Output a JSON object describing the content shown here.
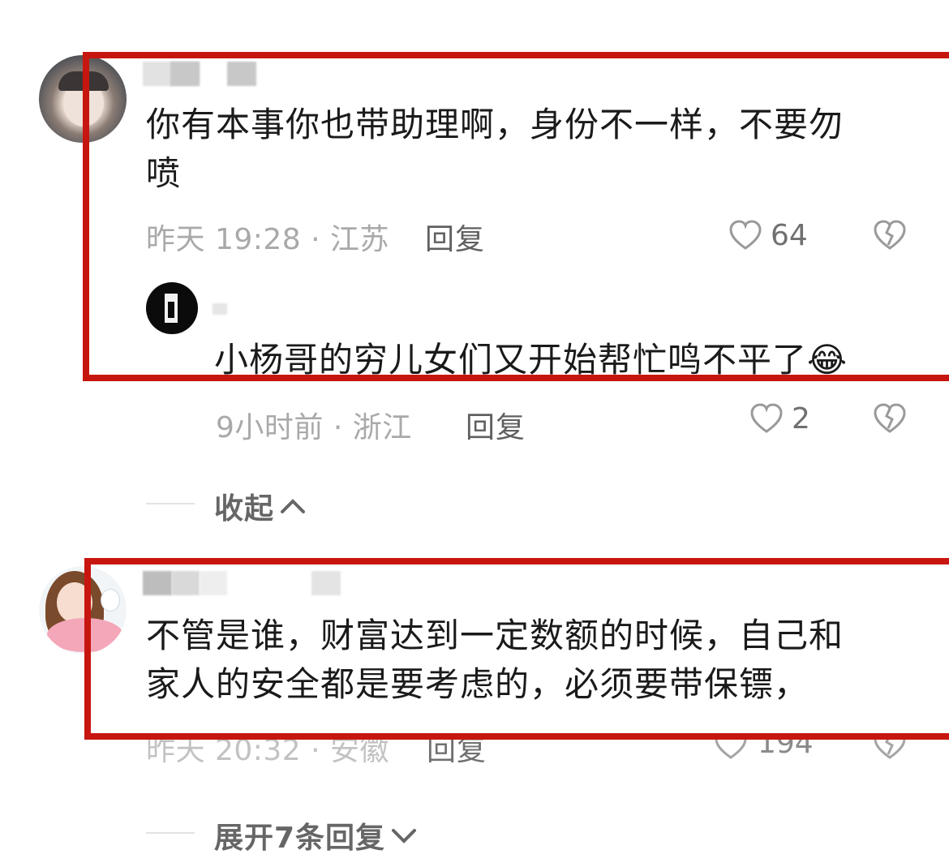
{
  "comments": [
    {
      "text_line1": "你有本事你也带助理啊，身份不一样，不要勿",
      "text_line2": "喷",
      "meta": "昨天 19:28 · 江苏",
      "reply_label": "回复",
      "likes": "64",
      "reply": {
        "text": "小杨哥的穷儿女们又开始帮忙鸣不平了",
        "emoji": "😂",
        "meta": "9小时前 · 浙江",
        "reply_label": "回复",
        "likes": "2"
      },
      "collapse_label": "收起"
    },
    {
      "text_line1": "不管是谁，财富达到一定数额的时候，自己和",
      "text_line2": "家人的安全都是要考虑的，必须要带保镖，",
      "meta": "昨天 20:32 · 安徽",
      "reply_label": "回复",
      "likes": "194",
      "expand_label": "展开7条回复"
    }
  ],
  "icons": {
    "like": "heart-outline-icon",
    "dislike": "broken-heart-icon",
    "collapse": "chevron-up-icon",
    "expand": "chevron-down-icon"
  },
  "colors": {
    "highlight_box": "#c7160f",
    "meta_text": "#a9a9a9"
  }
}
